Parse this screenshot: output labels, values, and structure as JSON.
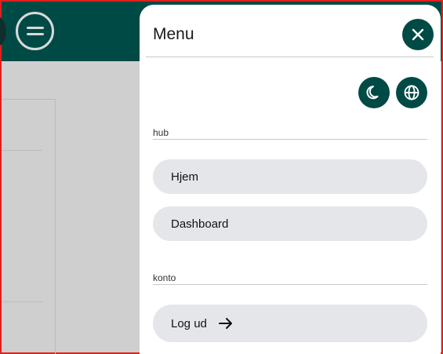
{
  "colors": {
    "brand": "#004a45",
    "pill_bg": "#e5e6e9",
    "frame_border": "#e0201e"
  },
  "topbar": {
    "menu_icon": "hamburger-icon"
  },
  "drawer": {
    "title": "Menu",
    "close_icon": "close-icon",
    "actions": [
      {
        "icon": "moon-icon"
      },
      {
        "icon": "globe-icon"
      }
    ],
    "sections": [
      {
        "label": "hub",
        "items": [
          {
            "label": "Hjem"
          },
          {
            "label": "Dashboard"
          }
        ]
      },
      {
        "label": "konto",
        "items": [
          {
            "label": "Log ud",
            "icon": "arrow-right-icon"
          }
        ]
      }
    ]
  }
}
